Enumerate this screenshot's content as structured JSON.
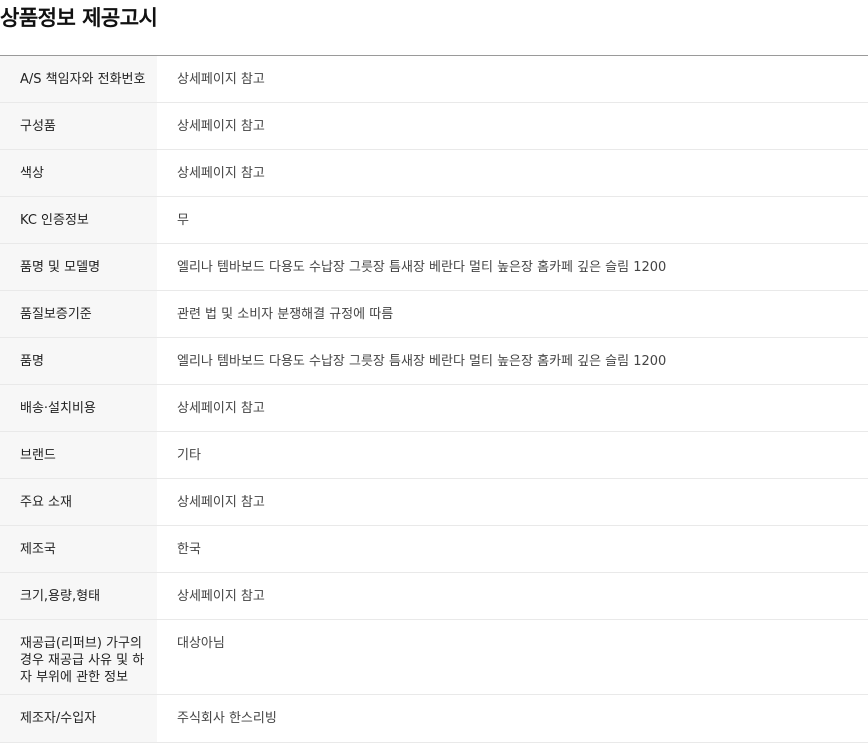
{
  "title": "상품정보 제공고시",
  "rows": [
    {
      "label": "A/S 책임자와 전화번호",
      "value": "상세페이지 참고"
    },
    {
      "label": "구성품",
      "value": "상세페이지 참고"
    },
    {
      "label": "색상",
      "value": "상세페이지 참고"
    },
    {
      "label": "KC 인증정보",
      "value": "무"
    },
    {
      "label": "품명 및 모델명",
      "value": "엘리나 템바보드 다용도 수납장 그릇장 틈새장 베란다 멀티 높은장 홈카페 깊은 슬림 1200"
    },
    {
      "label": "품질보증기준",
      "value": "관련 법 및 소비자 분쟁해결 규정에 따름"
    },
    {
      "label": "품명",
      "value": "엘리나 템바보드 다용도 수납장 그릇장 틈새장 베란다 멀티 높은장 홈카페 깊은 슬림 1200"
    },
    {
      "label": "배송·설치비용",
      "value": "상세페이지 참고"
    },
    {
      "label": "브랜드",
      "value": "기타"
    },
    {
      "label": "주요 소재",
      "value": "상세페이지 참고"
    },
    {
      "label": "제조국",
      "value": "한국"
    },
    {
      "label": "크기,용량,형태",
      "value": "상세페이지 참고"
    },
    {
      "label": "재공급(리퍼브) 가구의 경우 재공급 사유 및 하자 부위에 관한 정보",
      "value": "대상아님"
    },
    {
      "label": "제조자/수입자",
      "value": "주식회사 한스리빙"
    }
  ]
}
